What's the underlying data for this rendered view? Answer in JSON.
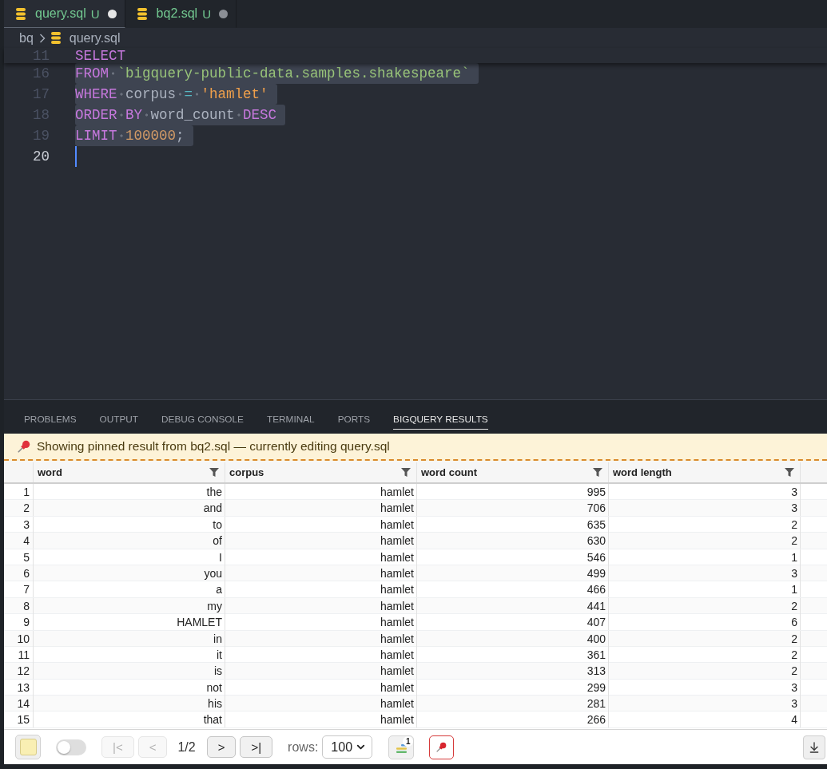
{
  "tabs": [
    {
      "label": "query.sql",
      "status": "U",
      "selected": true,
      "unsaved": true
    },
    {
      "label": "bq2.sql",
      "status": "U",
      "selected": false,
      "unsaved": true
    }
  ],
  "breadcrumb": [
    {
      "label": "bq",
      "kind": "folder"
    },
    {
      "label": "query.sql",
      "kind": "file"
    }
  ],
  "editor": {
    "sticky_line": {
      "number": "11",
      "tokens": [
        {
          "kind": "keyword",
          "text": "SELECT"
        }
      ]
    },
    "lines": [
      {
        "number": "16",
        "selected": true,
        "current": false,
        "tokens": [
          {
            "kind": "keyword",
            "text": "FROM"
          },
          {
            "kind": "space"
          },
          {
            "kind": "quoted",
            "text": "`bigquery-public-data.samples.shakespeare`"
          }
        ]
      },
      {
        "number": "17",
        "selected": true,
        "current": false,
        "tokens": [
          {
            "kind": "keyword",
            "text": "WHERE"
          },
          {
            "kind": "space"
          },
          {
            "kind": "identifier",
            "text": "corpus"
          },
          {
            "kind": "space"
          },
          {
            "kind": "operator",
            "text": "="
          },
          {
            "kind": "space"
          },
          {
            "kind": "literal",
            "text": "'hamlet'"
          }
        ]
      },
      {
        "number": "18",
        "selected": true,
        "current": false,
        "tokens": [
          {
            "kind": "keyword",
            "text": "ORDER"
          },
          {
            "kind": "space"
          },
          {
            "kind": "keyword",
            "text": "BY"
          },
          {
            "kind": "space"
          },
          {
            "kind": "identifier",
            "text": "word_count"
          },
          {
            "kind": "space"
          },
          {
            "kind": "keyword",
            "text": "DESC"
          }
        ]
      },
      {
        "number": "19",
        "selected": true,
        "current": false,
        "tokens": [
          {
            "kind": "keyword",
            "text": "LIMIT"
          },
          {
            "kind": "space"
          },
          {
            "kind": "number",
            "text": "100000"
          },
          {
            "kind": "punct",
            "text": ";"
          }
        ]
      },
      {
        "number": "20",
        "selected": false,
        "current": true
      }
    ]
  },
  "panel_tabs": [
    {
      "label": "PROBLEMS",
      "selected": false
    },
    {
      "label": "OUTPUT",
      "selected": false
    },
    {
      "label": "DEBUG CONSOLE",
      "selected": false
    },
    {
      "label": "TERMINAL",
      "selected": false
    },
    {
      "label": "PORTS",
      "selected": false
    },
    {
      "label": "BIGQUERY RESULTS",
      "selected": true
    }
  ],
  "banner": {
    "text": "Showing pinned result from bq2.sql — currently editing query.sql"
  },
  "table": {
    "columns": [
      "word",
      "corpus",
      "word count",
      "word length"
    ],
    "rows": [
      {
        "index": "1",
        "cells": [
          "the",
          "hamlet",
          "995",
          "3"
        ]
      },
      {
        "index": "2",
        "cells": [
          "and",
          "hamlet",
          "706",
          "3"
        ]
      },
      {
        "index": "3",
        "cells": [
          "to",
          "hamlet",
          "635",
          "2"
        ]
      },
      {
        "index": "4",
        "cells": [
          "of",
          "hamlet",
          "630",
          "2"
        ]
      },
      {
        "index": "5",
        "cells": [
          "I",
          "hamlet",
          "546",
          "1"
        ]
      },
      {
        "index": "6",
        "cells": [
          "you",
          "hamlet",
          "499",
          "3"
        ]
      },
      {
        "index": "7",
        "cells": [
          "a",
          "hamlet",
          "466",
          "1"
        ]
      },
      {
        "index": "8",
        "cells": [
          "my",
          "hamlet",
          "441",
          "2"
        ]
      },
      {
        "index": "9",
        "cells": [
          "HAMLET",
          "hamlet",
          "407",
          "6"
        ]
      },
      {
        "index": "10",
        "cells": [
          "in",
          "hamlet",
          "400",
          "2"
        ]
      },
      {
        "index": "11",
        "cells": [
          "it",
          "hamlet",
          "361",
          "2"
        ]
      },
      {
        "index": "12",
        "cells": [
          "is",
          "hamlet",
          "313",
          "2"
        ]
      },
      {
        "index": "13",
        "cells": [
          "not",
          "hamlet",
          "299",
          "3"
        ]
      },
      {
        "index": "14",
        "cells": [
          "his",
          "hamlet",
          "281",
          "3"
        ]
      },
      {
        "index": "15",
        "cells": [
          "that",
          "hamlet",
          "266",
          "4"
        ]
      }
    ]
  },
  "footer": {
    "toggle": {
      "on": false
    },
    "nav_back": [
      {
        "label": "|<",
        "disabled": true
      },
      {
        "label": "<",
        "disabled": true
      }
    ],
    "page": "1/2",
    "nav_forward": [
      {
        "label": ">",
        "disabled": false
      },
      {
        "label": ">|",
        "disabled": false
      }
    ],
    "rows_label": "rows:",
    "rows_value": "100",
    "badge": "1",
    "pin": {
      "on": true
    }
  }
}
